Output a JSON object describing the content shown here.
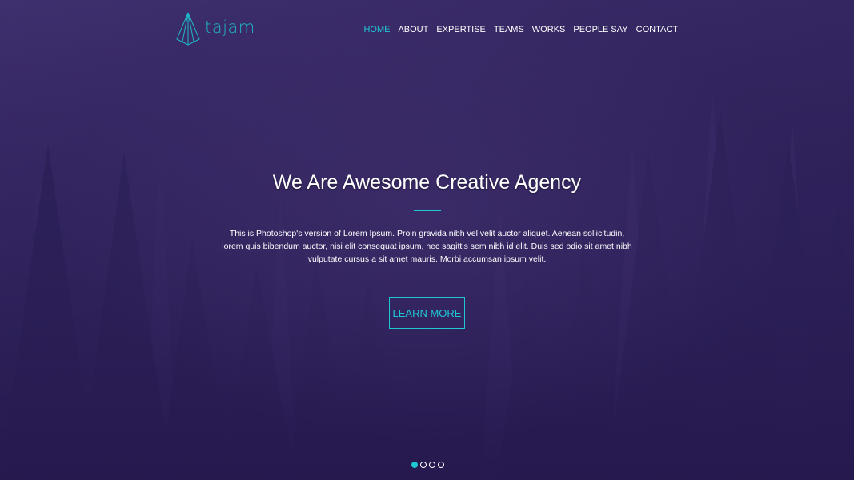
{
  "brand": {
    "name": "tajam",
    "logo_icon": "paper-plane-logo-icon",
    "accent_color": "#1fc7d4"
  },
  "nav": {
    "items": [
      {
        "label": "HOME",
        "active": true
      },
      {
        "label": "ABOUT",
        "active": false
      },
      {
        "label": "EXPERTISE",
        "active": false
      },
      {
        "label": "TEAMS",
        "active": false
      },
      {
        "label": "WORKS",
        "active": false
      },
      {
        "label": "PEOPLE SAY",
        "active": false
      },
      {
        "label": "CONTACT",
        "active": false
      }
    ]
  },
  "hero": {
    "title": "We Are Awesome Creative Agency",
    "text": "This is Photoshop's version of Lorem Ipsum. Proin gravida nibh vel velit auctor aliquet. Aenean sollicitudin, lorem quis bibendum auctor, nisi elit consequat ipsum, nec sagittis sem nibh id elit. Duis sed odio sit amet nibh vulputate cursus a sit amet mauris. Morbi accumsan ipsum velit.",
    "button_label": "LEARN MORE",
    "background_color": "#33255f"
  },
  "slider": {
    "slide_count": 4,
    "active_index": 0
  }
}
